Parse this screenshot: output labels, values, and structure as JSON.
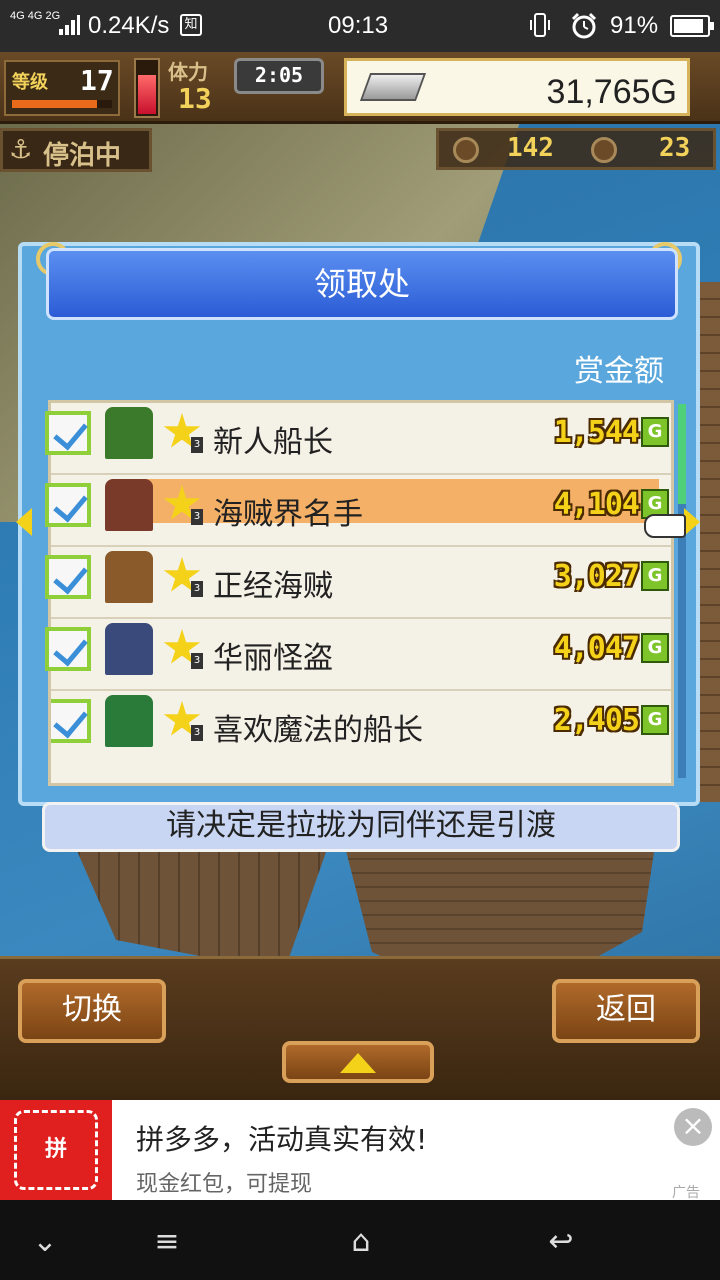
{
  "status_bar": {
    "network": "4G 4G 2G",
    "speed": "0.24K/s",
    "notification_icon": "知",
    "time": "09:13",
    "battery_percent": "91%",
    "battery_level": 0.91
  },
  "hud": {
    "level_label": "等级",
    "level": "17",
    "stamina_label": "体力",
    "stamina": "13",
    "timer": "2:05",
    "money": "31,765G",
    "status_label": "停泊中",
    "resource_a": "142",
    "resource_b": "23"
  },
  "panel": {
    "title": "领取处",
    "column_header": "赏金额",
    "rows": [
      {
        "title": "新人船长",
        "reward": "1,544",
        "stars": "3",
        "selected": false,
        "avatar_color": "#3b7a2a"
      },
      {
        "title": "海贼界名手",
        "reward": "4,104",
        "stars": "3",
        "selected": true,
        "avatar_color": "#7a3a2a"
      },
      {
        "title": "正经海贼",
        "reward": "3,027",
        "stars": "3",
        "selected": false,
        "avatar_color": "#8a5a2a"
      },
      {
        "title": "华丽怪盗",
        "reward": "4,047",
        "stars": "3",
        "selected": false,
        "avatar_color": "#3a4a7a"
      },
      {
        "title": "喜欢魔法的船长",
        "reward": "2,405",
        "stars": "3",
        "selected": false,
        "avatar_color": "#2a7a3a"
      }
    ],
    "currency_mark": "G",
    "message": "请决定是拉拢为同伴还是引渡"
  },
  "buttons": {
    "switch": "切换",
    "back": "返回"
  },
  "ad": {
    "logo_text": "拼",
    "title": "拼多多，活动真实有效!",
    "subtitle": "现金红包，可提现",
    "tag": "广告",
    "close": "×"
  },
  "navbar": {
    "down": "⌄",
    "menu": "≡",
    "home": "⌂",
    "back": "↩"
  }
}
